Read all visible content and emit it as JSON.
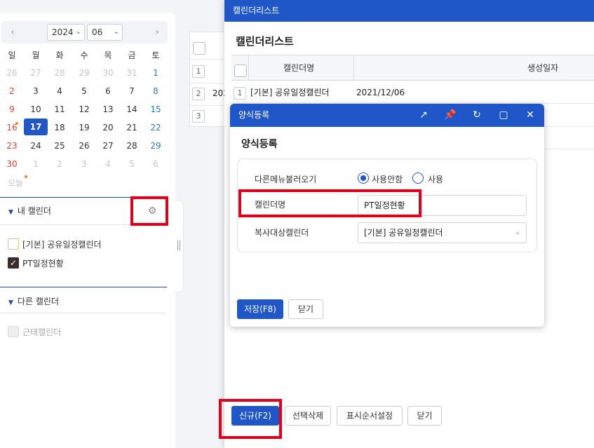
{
  "calendar": {
    "year": "2024",
    "month": "06",
    "weekdays": [
      "일",
      "월",
      "화",
      "수",
      "목",
      "금",
      "토"
    ],
    "weeks": [
      [
        "26",
        "27",
        "28",
        "29",
        "30",
        "31",
        "1"
      ],
      [
        "2",
        "3",
        "4",
        "5",
        "6",
        "7",
        "8"
      ],
      [
        "9",
        "10",
        "11",
        "12",
        "13",
        "14",
        "15"
      ],
      [
        "16",
        "17",
        "18",
        "19",
        "20",
        "21",
        "22"
      ],
      [
        "23",
        "24",
        "25",
        "26",
        "27",
        "28",
        "29"
      ],
      [
        "30",
        "1",
        "2",
        "3",
        "4",
        "5",
        "6"
      ]
    ],
    "today_label": "오늘",
    "selected_day": "17"
  },
  "my_calendars": {
    "title": "내 캘린더",
    "items": [
      {
        "label": "[기본] 공유일정캘린더",
        "checked": false
      },
      {
        "label": "PT일정현황",
        "checked": true
      }
    ]
  },
  "other_calendars": {
    "title": "다른 캘린더",
    "items": [
      {
        "label": "근태캘린더",
        "checked": false,
        "disabled": true
      }
    ]
  },
  "bg_table": {
    "rows": [
      "1",
      "2",
      "3"
    ],
    "partial_text": "202"
  },
  "list_window": {
    "title_bar": "캘린더리스트",
    "heading": "캘린더리스트",
    "columns": [
      "캘린더명",
      "생성일자"
    ],
    "rows": [
      {
        "no": "1",
        "name": "[기본] 공유일정캘린더",
        "date": "2021/12/06"
      }
    ],
    "buttons": {
      "new": "신규(F2)",
      "delete_selected": "선택삭제",
      "display_order": "표시순서설정",
      "close": "닫기"
    }
  },
  "form_dialog": {
    "title_bar": "양식등록",
    "heading": "양식등록",
    "fields": {
      "load_other_menu_label": "다른메뉴불러오기",
      "option_no": "사용안함",
      "option_yes": "사용",
      "selected_option": "사용안함",
      "calendar_name_label": "캘린더명",
      "calendar_name_value": "PT일정현황",
      "copy_target_label": "복사대상캘린더",
      "copy_target_value": "[기본] 공유일정캘린더"
    },
    "buttons": {
      "save": "저장(F8)",
      "close": "닫기"
    }
  },
  "colors": {
    "primary": "#1f56c8",
    "highlight_box": "#e0001b",
    "sunday": "#e0443c",
    "saturday": "#2a7ec2",
    "event_dot": "#f08a2c"
  },
  "icons": {
    "prev": "chevron-left-icon",
    "next": "chevron-right-icon",
    "settings": "gear-icon",
    "popout": "external-link-icon",
    "pin": "pin-icon",
    "refresh": "refresh-icon",
    "maximize": "maximize-icon",
    "close": "close-icon"
  }
}
